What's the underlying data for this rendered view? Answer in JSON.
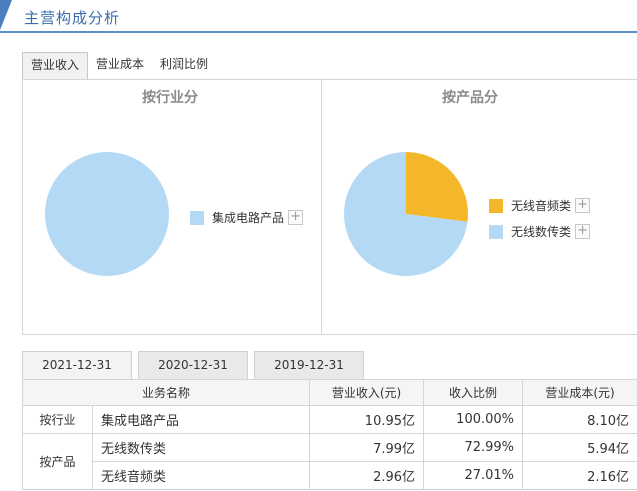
{
  "header": {
    "title": "主营构成分析"
  },
  "tabs": [
    {
      "label": "营业收入",
      "active": true
    },
    {
      "label": "营业成本",
      "active": false
    },
    {
      "label": "利润比例",
      "active": false
    }
  ],
  "charts": {
    "left": {
      "title": "按行业分",
      "legend": [
        {
          "label": "集成电路产品",
          "color": "#b3d9f5",
          "plus": "+"
        }
      ]
    },
    "right": {
      "title": "按产品分",
      "legend": [
        {
          "label": "无线音频类",
          "color": "#f5b72a",
          "plus": "+"
        },
        {
          "label": "无线数传类",
          "color": "#b3d9f5",
          "plus": "+"
        }
      ]
    }
  },
  "chart_data": [
    {
      "type": "pie",
      "title": "按行业分",
      "categories": [
        "集成电路产品"
      ],
      "values": [
        100.0
      ],
      "colors": [
        "#b3d9f5"
      ]
    },
    {
      "type": "pie",
      "title": "按产品分",
      "categories": [
        "无线音频类",
        "无线数传类"
      ],
      "values": [
        27.01,
        72.99
      ],
      "colors": [
        "#f5b72a",
        "#b3d9f5"
      ]
    }
  ],
  "date_tabs": [
    {
      "label": "2021-12-31",
      "active": true
    },
    {
      "label": "2020-12-31",
      "active": false
    },
    {
      "label": "2019-12-31",
      "active": false
    }
  ],
  "table": {
    "headers": [
      "业务名称",
      "营业收入(元)",
      "收入比例",
      "营业成本(元)"
    ],
    "groups": [
      {
        "category": "按行业",
        "rows": [
          {
            "name": "集成电路产品",
            "revenue": "10.95亿",
            "ratio": "100.00%",
            "cost": "8.10亿"
          }
        ]
      },
      {
        "category": "按产品",
        "rows": [
          {
            "name": "无线数传类",
            "revenue": "7.99亿",
            "ratio": "72.99%",
            "cost": "5.94亿"
          },
          {
            "name": "无线音频类",
            "revenue": "2.96亿",
            "ratio": "27.01%",
            "cost": "2.16亿"
          }
        ]
      }
    ]
  }
}
